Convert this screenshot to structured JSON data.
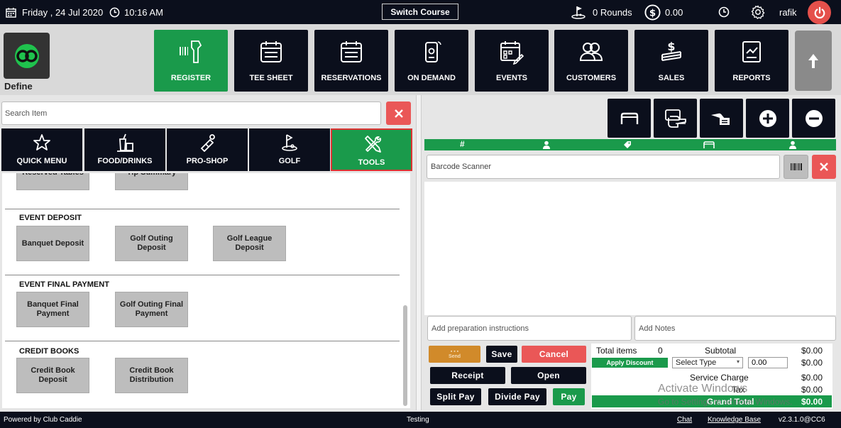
{
  "topbar": {
    "date": "Friday ,  24 Jul 2020",
    "time": "10:16 AM",
    "switch_course": "Switch Course",
    "rounds": "0 Rounds",
    "balance": "0.00",
    "user": "rafik"
  },
  "logo": {
    "label": "Define"
  },
  "nav": {
    "register": "REGISTER",
    "tee_sheet": "TEE SHEET",
    "reservations": "RESERVATIONS",
    "on_demand": "ON DEMAND",
    "events": "EVENTS",
    "customers": "CUSTOMERS",
    "sales": "SALES",
    "reports": "REPORTS"
  },
  "search": {
    "placeholder": "Search Item"
  },
  "categories": {
    "quick_menu": "QUICK MENU",
    "food_drinks": "FOOD/DRINKS",
    "pro_shop": "PRO-SHOP",
    "golf": "GOLF",
    "tools": "TOOLS"
  },
  "items": {
    "partial_1": "Reserved Tables",
    "partial_2": "Tip Summary",
    "event_deposit_title": "EVENT DEPOSIT",
    "banquet_deposit": "Banquet Deposit",
    "golf_outing_deposit": "Golf Outing Deposit",
    "golf_league_deposit": "Golf League Deposit",
    "event_final_title": "EVENT FINAL PAYMENT",
    "banquet_final": "Banquet Final Payment",
    "golf_outing_final": "Golf Outing Final Payment",
    "credit_books_title": "CREDIT BOOKS",
    "credit_book_deposit": "Credit Book Deposit",
    "credit_book_distribution": "Credit Book Distribution"
  },
  "cart": {
    "col_number": "#",
    "barcode_placeholder": "Barcode Scanner",
    "prep_placeholder": "Add preparation instructions",
    "notes_placeholder": "Add Notes"
  },
  "buttons": {
    "send": "Send",
    "save": "Save",
    "cancel": "Cancel",
    "receipt": "Receipt",
    "open": "Open",
    "split_pay": "Split Pay",
    "divide_pay": "Divide Pay",
    "pay": "Pay"
  },
  "totals": {
    "total_items_label": "Total items",
    "total_items_value": "0",
    "subtotal_label": "Subtotal",
    "subtotal_value": "$0.00",
    "apply_discount": "Apply Discount",
    "select_type": "Select Type",
    "discount_value": "0.00",
    "discount_amount": "$0.00",
    "service_charge_label": "Service Charge",
    "service_charge_value": "$0.00",
    "tax_label": "Tax",
    "tax_value": "$0.00",
    "grand_total_label": "Grand Total",
    "grand_total_value": "$0.00"
  },
  "watermark": {
    "line1": "Activate Windows",
    "line2": "Go to Settings to activate Windows."
  },
  "footer": {
    "powered_by": "Powered by Club Caddie",
    "environment": "Testing",
    "chat": "Chat",
    "knowledge_base": "Knowledge Base",
    "version": "v2.3.1.0@CC6"
  }
}
